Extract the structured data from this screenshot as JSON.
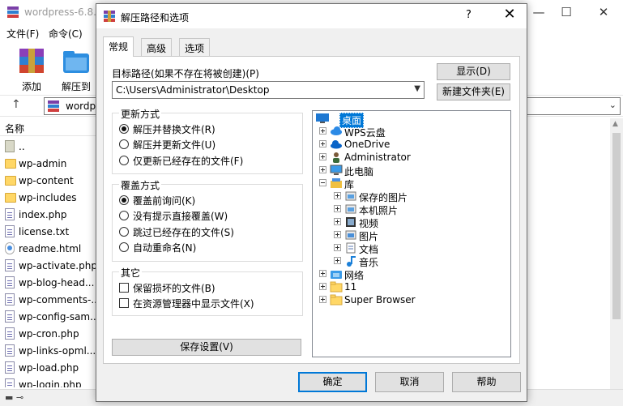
{
  "background_window": {
    "title": "wordpress-6.8.",
    "menu": [
      "文件(F)",
      "命令(C)"
    ],
    "toolbar": [
      "添加",
      "解压到"
    ],
    "address": "wordp",
    "column_name": "名称",
    "files": [
      "..",
      "wp-admin",
      "wp-content",
      "wp-includes",
      "index.php",
      "license.txt",
      "readme.html",
      "wp-activate.php",
      "wp-blog-head...",
      "wp-comments-...",
      "wp-config-sam...",
      "wp-cron.php",
      "wp-links-opml...",
      "wp-load.php",
      "wp-login.php"
    ],
    "controls": {
      "minimize": "—",
      "maximize": "☐",
      "close": "✕"
    }
  },
  "dialog": {
    "title": "解压路径和选项",
    "help": "?",
    "close": "✕",
    "tabs": [
      "常规",
      "高级",
      "选项"
    ],
    "path_label": "目标路径(如果不存在将被创建)(P)",
    "path_value": "C:\\Users\\Administrator\\Desktop",
    "show_button": "显示(D)",
    "new_folder_button": "新建文件夹(E)",
    "update_group": {
      "title": "更新方式",
      "options": [
        "解压并替换文件(R)",
        "解压并更新文件(U)",
        "仅更新已经存在的文件(F)"
      ],
      "selected": 0
    },
    "overwrite_group": {
      "title": "覆盖方式",
      "options": [
        "覆盖前询问(K)",
        "没有提示直接覆盖(W)",
        "跳过已经存在的文件(S)",
        "自动重命名(N)"
      ],
      "selected": 0
    },
    "misc_group": {
      "title": "其它",
      "options": [
        "保留损坏的文件(B)",
        "在资源管理器中显示文件(X)"
      ]
    },
    "save_button": "保存设置(V)",
    "tree": [
      "桌面",
      "WPS云盘",
      "OneDrive",
      "Administrator",
      "此电脑",
      "库",
      "保存的图片",
      "本机照片",
      "视频",
      "图片",
      "文档",
      "音乐",
      "网络",
      "11",
      "Super Browser"
    ],
    "ok_button": "确定",
    "cancel_button": "取消",
    "help_button": "帮助"
  }
}
